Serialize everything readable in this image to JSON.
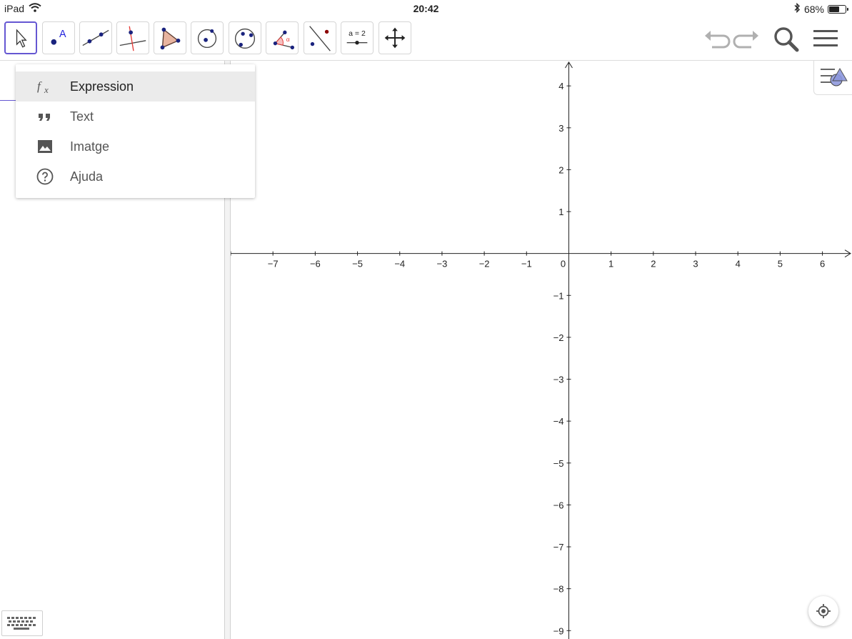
{
  "status_bar": {
    "device": "iPad",
    "time": "20:42",
    "battery_text": "68%",
    "battery_level": 0.68,
    "icons": [
      "wifi-icon",
      "bluetooth-icon",
      "battery-icon"
    ]
  },
  "toolbar": {
    "tools": [
      {
        "icon": "move-arrow-icon"
      },
      {
        "icon": "point-icon",
        "text": "A"
      },
      {
        "icon": "line-icon"
      },
      {
        "icon": "perpendicular-line-icon"
      },
      {
        "icon": "polygon-icon"
      },
      {
        "icon": "circle-center-point-icon"
      },
      {
        "icon": "circle-three-points-icon"
      },
      {
        "icon": "angle-icon",
        "text": "α"
      },
      {
        "icon": "reflect-about-line-icon"
      },
      {
        "icon": "slider-icon",
        "text": "a = 2"
      },
      {
        "icon": "move-graphics-icon"
      }
    ],
    "right_icons": [
      "undo-icon",
      "redo-icon",
      "search-icon",
      "menu-icon"
    ],
    "accent_color": "#6557d2"
  },
  "input_menu": {
    "items": [
      {
        "label": "Expression",
        "icon": "function-fx-icon",
        "active": true
      },
      {
        "label": "Text",
        "icon": "quote-icon",
        "active": false
      },
      {
        "label": "Imatge",
        "icon": "image-icon",
        "active": false
      },
      {
        "label": "Ajuda",
        "icon": "help-circle-icon",
        "active": false
      }
    ]
  },
  "graphics": {
    "x_ticks": [
      "−7",
      "−6",
      "−5",
      "−4",
      "−3",
      "−2",
      "−1",
      "0",
      "1",
      "2",
      "3",
      "4",
      "5",
      "6"
    ],
    "y_ticks": [
      "4",
      "3",
      "2",
      "1",
      "−1",
      "−2",
      "−3",
      "−4",
      "−5",
      "−6",
      "−7",
      "−8",
      "−9"
    ],
    "x_range": [
      -8,
      6.7
    ],
    "y_range": [
      -9.2,
      4.6
    ]
  },
  "misc_icons": [
    "style-bar-icon",
    "keyboard-icon",
    "locate-icon"
  ]
}
